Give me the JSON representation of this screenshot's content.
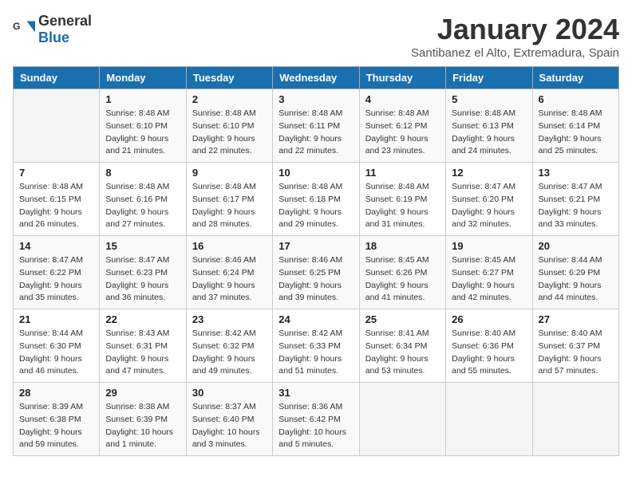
{
  "logo": {
    "general": "General",
    "blue": "Blue"
  },
  "title": "January 2024",
  "subtitle": "Santibanez el Alto, Extremadura, Spain",
  "weekdays": [
    "Sunday",
    "Monday",
    "Tuesday",
    "Wednesday",
    "Thursday",
    "Friday",
    "Saturday"
  ],
  "weeks": [
    [
      {
        "day": "",
        "sunrise": "",
        "sunset": "",
        "daylight": ""
      },
      {
        "day": "1",
        "sunrise": "Sunrise: 8:48 AM",
        "sunset": "Sunset: 6:10 PM",
        "daylight": "Daylight: 9 hours and 21 minutes."
      },
      {
        "day": "2",
        "sunrise": "Sunrise: 8:48 AM",
        "sunset": "Sunset: 6:10 PM",
        "daylight": "Daylight: 9 hours and 22 minutes."
      },
      {
        "day": "3",
        "sunrise": "Sunrise: 8:48 AM",
        "sunset": "Sunset: 6:11 PM",
        "daylight": "Daylight: 9 hours and 22 minutes."
      },
      {
        "day": "4",
        "sunrise": "Sunrise: 8:48 AM",
        "sunset": "Sunset: 6:12 PM",
        "daylight": "Daylight: 9 hours and 23 minutes."
      },
      {
        "day": "5",
        "sunrise": "Sunrise: 8:48 AM",
        "sunset": "Sunset: 6:13 PM",
        "daylight": "Daylight: 9 hours and 24 minutes."
      },
      {
        "day": "6",
        "sunrise": "Sunrise: 8:48 AM",
        "sunset": "Sunset: 6:14 PM",
        "daylight": "Daylight: 9 hours and 25 minutes."
      }
    ],
    [
      {
        "day": "7",
        "sunrise": "Sunrise: 8:48 AM",
        "sunset": "Sunset: 6:15 PM",
        "daylight": "Daylight: 9 hours and 26 minutes."
      },
      {
        "day": "8",
        "sunrise": "Sunrise: 8:48 AM",
        "sunset": "Sunset: 6:16 PM",
        "daylight": "Daylight: 9 hours and 27 minutes."
      },
      {
        "day": "9",
        "sunrise": "Sunrise: 8:48 AM",
        "sunset": "Sunset: 6:17 PM",
        "daylight": "Daylight: 9 hours and 28 minutes."
      },
      {
        "day": "10",
        "sunrise": "Sunrise: 8:48 AM",
        "sunset": "Sunset: 6:18 PM",
        "daylight": "Daylight: 9 hours and 29 minutes."
      },
      {
        "day": "11",
        "sunrise": "Sunrise: 8:48 AM",
        "sunset": "Sunset: 6:19 PM",
        "daylight": "Daylight: 9 hours and 31 minutes."
      },
      {
        "day": "12",
        "sunrise": "Sunrise: 8:47 AM",
        "sunset": "Sunset: 6:20 PM",
        "daylight": "Daylight: 9 hours and 32 minutes."
      },
      {
        "day": "13",
        "sunrise": "Sunrise: 8:47 AM",
        "sunset": "Sunset: 6:21 PM",
        "daylight": "Daylight: 9 hours and 33 minutes."
      }
    ],
    [
      {
        "day": "14",
        "sunrise": "Sunrise: 8:47 AM",
        "sunset": "Sunset: 6:22 PM",
        "daylight": "Daylight: 9 hours and 35 minutes."
      },
      {
        "day": "15",
        "sunrise": "Sunrise: 8:47 AM",
        "sunset": "Sunset: 6:23 PM",
        "daylight": "Daylight: 9 hours and 36 minutes."
      },
      {
        "day": "16",
        "sunrise": "Sunrise: 8:46 AM",
        "sunset": "Sunset: 6:24 PM",
        "daylight": "Daylight: 9 hours and 37 minutes."
      },
      {
        "day": "17",
        "sunrise": "Sunrise: 8:46 AM",
        "sunset": "Sunset: 6:25 PM",
        "daylight": "Daylight: 9 hours and 39 minutes."
      },
      {
        "day": "18",
        "sunrise": "Sunrise: 8:45 AM",
        "sunset": "Sunset: 6:26 PM",
        "daylight": "Daylight: 9 hours and 41 minutes."
      },
      {
        "day": "19",
        "sunrise": "Sunrise: 8:45 AM",
        "sunset": "Sunset: 6:27 PM",
        "daylight": "Daylight: 9 hours and 42 minutes."
      },
      {
        "day": "20",
        "sunrise": "Sunrise: 8:44 AM",
        "sunset": "Sunset: 6:29 PM",
        "daylight": "Daylight: 9 hours and 44 minutes."
      }
    ],
    [
      {
        "day": "21",
        "sunrise": "Sunrise: 8:44 AM",
        "sunset": "Sunset: 6:30 PM",
        "daylight": "Daylight: 9 hours and 46 minutes."
      },
      {
        "day": "22",
        "sunrise": "Sunrise: 8:43 AM",
        "sunset": "Sunset: 6:31 PM",
        "daylight": "Daylight: 9 hours and 47 minutes."
      },
      {
        "day": "23",
        "sunrise": "Sunrise: 8:42 AM",
        "sunset": "Sunset: 6:32 PM",
        "daylight": "Daylight: 9 hours and 49 minutes."
      },
      {
        "day": "24",
        "sunrise": "Sunrise: 8:42 AM",
        "sunset": "Sunset: 6:33 PM",
        "daylight": "Daylight: 9 hours and 51 minutes."
      },
      {
        "day": "25",
        "sunrise": "Sunrise: 8:41 AM",
        "sunset": "Sunset: 6:34 PM",
        "daylight": "Daylight: 9 hours and 53 minutes."
      },
      {
        "day": "26",
        "sunrise": "Sunrise: 8:40 AM",
        "sunset": "Sunset: 6:36 PM",
        "daylight": "Daylight: 9 hours and 55 minutes."
      },
      {
        "day": "27",
        "sunrise": "Sunrise: 8:40 AM",
        "sunset": "Sunset: 6:37 PM",
        "daylight": "Daylight: 9 hours and 57 minutes."
      }
    ],
    [
      {
        "day": "28",
        "sunrise": "Sunrise: 8:39 AM",
        "sunset": "Sunset: 6:38 PM",
        "daylight": "Daylight: 9 hours and 59 minutes."
      },
      {
        "day": "29",
        "sunrise": "Sunrise: 8:38 AM",
        "sunset": "Sunset: 6:39 PM",
        "daylight": "Daylight: 10 hours and 1 minute."
      },
      {
        "day": "30",
        "sunrise": "Sunrise: 8:37 AM",
        "sunset": "Sunset: 6:40 PM",
        "daylight": "Daylight: 10 hours and 3 minutes."
      },
      {
        "day": "31",
        "sunrise": "Sunrise: 8:36 AM",
        "sunset": "Sunset: 6:42 PM",
        "daylight": "Daylight: 10 hours and 5 minutes."
      },
      {
        "day": "",
        "sunrise": "",
        "sunset": "",
        "daylight": ""
      },
      {
        "day": "",
        "sunrise": "",
        "sunset": "",
        "daylight": ""
      },
      {
        "day": "",
        "sunrise": "",
        "sunset": "",
        "daylight": ""
      }
    ]
  ]
}
